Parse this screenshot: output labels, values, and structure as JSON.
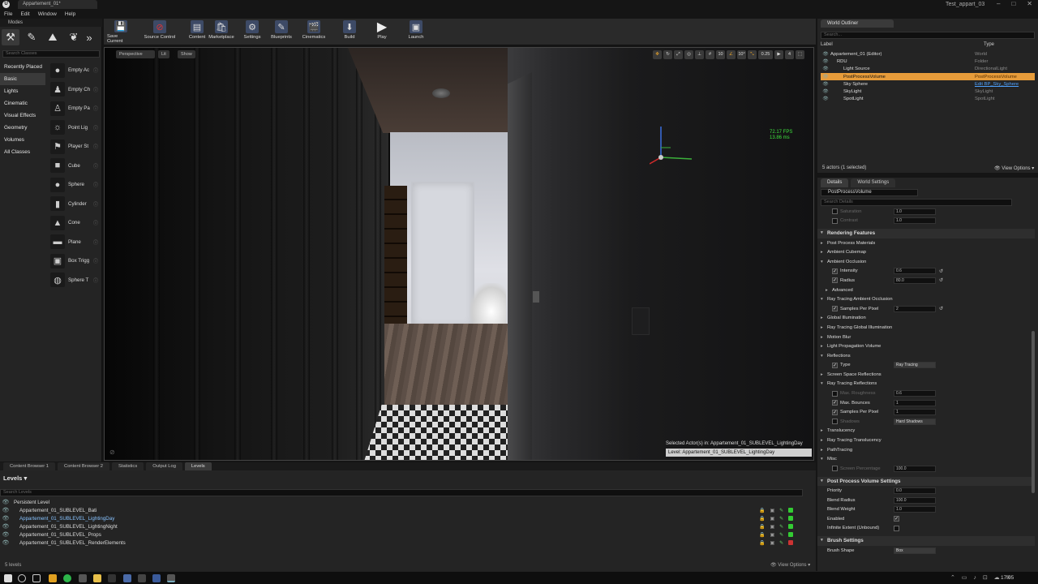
{
  "window": {
    "tab_title": "Appartement_01*",
    "project_name": "Test_appart_03",
    "menu": [
      "File",
      "Edit",
      "Window",
      "Help"
    ]
  },
  "modes": {
    "title": "Modes",
    "search_placeholder": "Search Classes",
    "categories": [
      "Recently Placed",
      "Basic",
      "Lights",
      "Cinematic",
      "Visual Effects",
      "Geometry",
      "Volumes",
      "All Classes"
    ],
    "selected_category": "Basic",
    "items": [
      {
        "label": "Empty Ac",
        "icon": "sphere-icon"
      },
      {
        "label": "Empty Ch",
        "icon": "character-icon"
      },
      {
        "label": "Empty Pa",
        "icon": "pawn-icon"
      },
      {
        "label": "Point Lig",
        "icon": "light-bulb-icon"
      },
      {
        "label": "Player St",
        "icon": "player-start-icon"
      },
      {
        "label": "Cube",
        "icon": "cube-icon"
      },
      {
        "label": "Sphere",
        "icon": "sphere-icon"
      },
      {
        "label": "Cylinder",
        "icon": "cylinder-icon"
      },
      {
        "label": "Cone",
        "icon": "cone-icon"
      },
      {
        "label": "Plane",
        "icon": "plane-icon"
      },
      {
        "label": "Box Trigg",
        "icon": "box-trigger-icon"
      },
      {
        "label": "Sphere T",
        "icon": "sphere-trigger-icon"
      }
    ]
  },
  "toolbar": {
    "buttons": [
      {
        "label": "Save Current",
        "icon": "save-icon"
      },
      {
        "label": "Source Control",
        "icon": "source-control-icon"
      },
      {
        "label": "Content",
        "icon": "content-icon"
      },
      {
        "label": "Marketplace",
        "icon": "marketplace-icon"
      },
      {
        "label": "Settings",
        "icon": "settings-icon"
      },
      {
        "label": "Blueprints",
        "icon": "blueprints-icon"
      },
      {
        "label": "Cinematics",
        "icon": "cinematics-icon"
      },
      {
        "label": "Build",
        "icon": "build-icon"
      },
      {
        "label": "Play",
        "icon": "play-icon"
      },
      {
        "label": "Launch",
        "icon": "launch-icon"
      }
    ]
  },
  "viewport": {
    "perspective": "Perspective",
    "lit": "Lit",
    "show": "Show",
    "fps": "72.17 FPS",
    "ms": "13.86 ms",
    "grid_snap": "10",
    "rot_snap": "10°",
    "scale_snap": "0.25",
    "cam_speed": "4",
    "selected_actors": "Selected Actor(s) in:  Appartement_01_SUBLEVEL_LightingDay",
    "level": "Level:  Appartement_01_SUBLEVEL_LightingDay"
  },
  "bottom_tabs": [
    "Content Browser 1",
    "Content Browser 2",
    "Statistics",
    "Output Log",
    "Levels"
  ],
  "bottom_tab_selected": "Levels",
  "levels": {
    "title": "Levels",
    "search_placeholder": "Search Levels",
    "rows": [
      {
        "name": "Persistent Level",
        "indent": 0
      },
      {
        "name": "Appartement_01_SUBLEVEL_Bati",
        "indent": 1
      },
      {
        "name": "Appartement_01_SUBLEVEL_LightingDay",
        "indent": 1,
        "selected": true
      },
      {
        "name": "Appartement_01_SUBLEVEL_LightingNight",
        "indent": 1
      },
      {
        "name": "Appartement_01_SUBLEVEL_Props",
        "indent": 1
      },
      {
        "name": "Appartement_01_SUBLEVEL_RenderElements",
        "indent": 1
      }
    ],
    "count": "5 levels",
    "view_options": "View Options"
  },
  "outliner": {
    "title": "World Outliner",
    "search_placeholder": "Search...",
    "col_label": "Label",
    "col_type": "Type",
    "rows": [
      {
        "label": "Appartement_01 (Editor)",
        "type": "World",
        "indent": 0
      },
      {
        "label": "RDU",
        "type": "Folder",
        "indent": 1
      },
      {
        "label": "Light Source",
        "type": "DirectionalLight",
        "indent": 2
      },
      {
        "label": "PostProcessVolume",
        "type": "PostProcessVolume",
        "indent": 2,
        "selected": true
      },
      {
        "label": "Sky Sphere",
        "type": "Edit BP_Sky_Sphere",
        "indent": 2,
        "type_link": true
      },
      {
        "label": "SkyLight",
        "type": "SkyLight",
        "indent": 2
      },
      {
        "label": "SpotLight",
        "type": "SpotLight",
        "indent": 2
      }
    ],
    "status": "5 actors (1 selected)",
    "view_options": "View Options"
  },
  "details": {
    "tabs": [
      "Details",
      "World Settings"
    ],
    "selected_tab": "Details",
    "object_name": "PostProcessVolume",
    "search_placeholder": "Search Details",
    "rows": [
      {
        "kind": "prop",
        "label": "Saturation",
        "value": "1.0",
        "dim": true,
        "indent": 1
      },
      {
        "kind": "prop",
        "label": "Contrast",
        "value": "1.0",
        "dim": true,
        "indent": 1
      },
      {
        "kind": "spacer"
      },
      {
        "kind": "cat",
        "label": "Rendering Features"
      },
      {
        "kind": "group",
        "label": "Post Process Materials",
        "open": false
      },
      {
        "kind": "group",
        "label": "Ambient Cubemap",
        "open": false
      },
      {
        "kind": "group",
        "label": "Ambient Occlusion",
        "open": true
      },
      {
        "kind": "prop",
        "label": "Intensity",
        "value": "0.6",
        "check": true,
        "reset": true,
        "indent": 1
      },
      {
        "kind": "prop",
        "label": "Radius",
        "value": "80.0",
        "check": true,
        "reset": true,
        "indent": 1
      },
      {
        "kind": "group",
        "label": "Advanced",
        "open": false,
        "indent": 1
      },
      {
        "kind": "group",
        "label": "Ray Tracing Ambient Occlusion",
        "open": true
      },
      {
        "kind": "prop",
        "label": "Samples Per Pixel",
        "value": "2",
        "check": true,
        "reset": true,
        "indent": 1
      },
      {
        "kind": "group",
        "label": "Global Illumination",
        "open": false
      },
      {
        "kind": "group",
        "label": "Ray Tracing Global Illumination",
        "open": false
      },
      {
        "kind": "group",
        "label": "Motion Blur",
        "open": false
      },
      {
        "kind": "group",
        "label": "Light Propagation Volume",
        "open": false
      },
      {
        "kind": "group",
        "label": "Reflections",
        "open": true
      },
      {
        "kind": "prop",
        "label": "Type",
        "value": "Ray Tracing",
        "check": true,
        "combo": true,
        "indent": 1
      },
      {
        "kind": "group",
        "label": "Screen Space Reflections",
        "open": false
      },
      {
        "kind": "group",
        "label": "Ray Tracing Reflections",
        "open": true
      },
      {
        "kind": "prop",
        "label": "Max. Roughness",
        "value": "0.6",
        "dim": true,
        "indent": 1
      },
      {
        "kind": "prop",
        "label": "Max. Bounces",
        "value": "1",
        "check": true,
        "indent": 1
      },
      {
        "kind": "prop",
        "label": "Samples Per Pixel",
        "value": "1",
        "check": true,
        "indent": 1
      },
      {
        "kind": "prop",
        "label": "Shadows",
        "value": "Hard Shadows",
        "dim": true,
        "combo": true,
        "indent": 1
      },
      {
        "kind": "group",
        "label": "Translucency",
        "open": false
      },
      {
        "kind": "group",
        "label": "Ray Tracing Translucency",
        "open": false
      },
      {
        "kind": "group",
        "label": "PathTracing",
        "open": false
      },
      {
        "kind": "group",
        "label": "Misc",
        "open": true
      },
      {
        "kind": "prop",
        "label": "Screen Percentage",
        "value": "100.0",
        "dim": true,
        "indent": 1
      },
      {
        "kind": "spacer"
      },
      {
        "kind": "cat",
        "label": "Post Process Volume Settings"
      },
      {
        "kind": "prop",
        "label": "Priority",
        "value": "0.0",
        "indent": 0
      },
      {
        "kind": "prop",
        "label": "Blend Radius",
        "value": "100.0",
        "indent": 0
      },
      {
        "kind": "prop",
        "label": "Blend Weight",
        "value": "1.0",
        "indent": 0
      },
      {
        "kind": "prop",
        "label": "Enabled",
        "check_only": true,
        "checked": true,
        "indent": 0
      },
      {
        "kind": "prop",
        "label": "Infinite Extent (Unbound)",
        "check_only": true,
        "checked": false,
        "indent": 0
      },
      {
        "kind": "spacer"
      },
      {
        "kind": "cat",
        "label": "Brush Settings"
      },
      {
        "kind": "prop",
        "label": "Brush Shape",
        "value": "Box",
        "combo": true,
        "indent": 0
      }
    ]
  },
  "taskbar": {
    "time": "17:05"
  }
}
